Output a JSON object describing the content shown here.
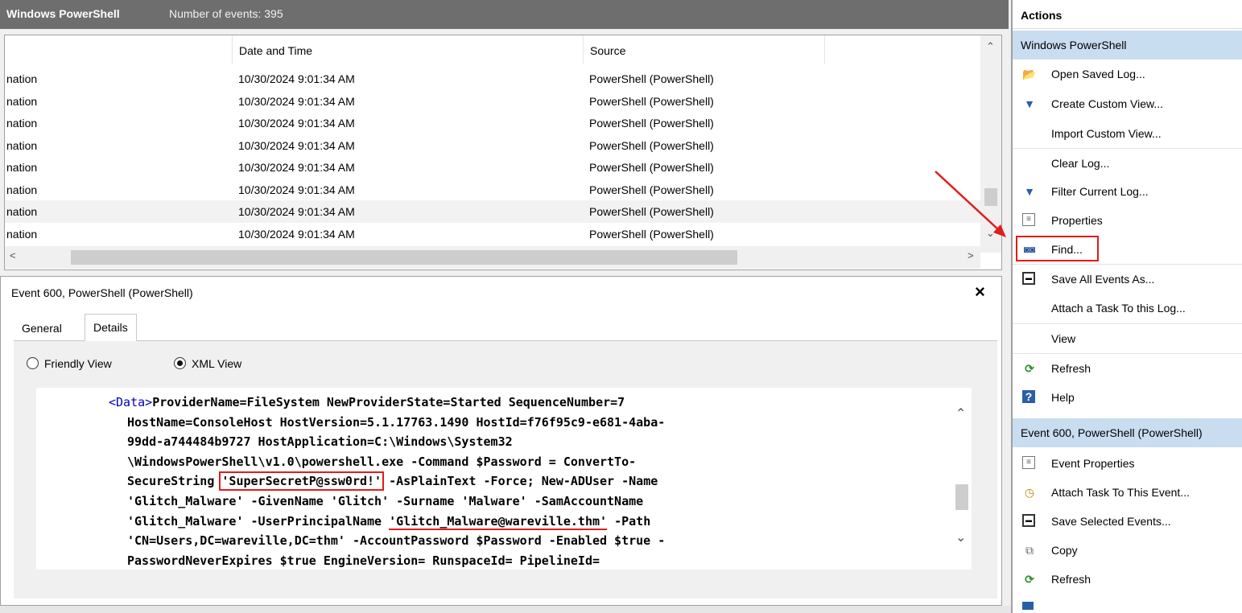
{
  "header": {
    "title": "Windows PowerShell",
    "event_count": "Number of events: 395"
  },
  "event_list": {
    "columns": [
      "",
      "Date and Time",
      "Source"
    ],
    "rows": [
      {
        "level": "nation",
        "date": "10/30/2024 9:01:34 AM",
        "source": "PowerShell (PowerShell)"
      },
      {
        "level": "nation",
        "date": "10/30/2024 9:01:34 AM",
        "source": "PowerShell (PowerShell)"
      },
      {
        "level": "nation",
        "date": "10/30/2024 9:01:34 AM",
        "source": "PowerShell (PowerShell)"
      },
      {
        "level": "nation",
        "date": "10/30/2024 9:01:34 AM",
        "source": "PowerShell (PowerShell)"
      },
      {
        "level": "nation",
        "date": "10/30/2024 9:01:34 AM",
        "source": "PowerShell (PowerShell)"
      },
      {
        "level": "nation",
        "date": "10/30/2024 9:01:34 AM",
        "source": "PowerShell (PowerShell)"
      },
      {
        "level": "nation",
        "date": "10/30/2024 9:01:34 AM",
        "source": "PowerShell (PowerShell)"
      },
      {
        "level": "nation",
        "date": "10/30/2024 9:01:34 AM",
        "source": "PowerShell (PowerShell)"
      }
    ]
  },
  "detail": {
    "title": "Event 600, PowerShell (PowerShell)",
    "close_glyph": "×",
    "tabs": {
      "general": "General",
      "details": "Details"
    },
    "views": {
      "friendly": "Friendly View",
      "xml": "XML View"
    },
    "xml": {
      "tag_open": "<Data>",
      "line1": "ProviderName=FileSystem NewProviderState=Started SequenceNumber=7",
      "line2": "HostName=ConsoleHost HostVersion=5.1.17763.1490 HostId=f76f95c9-e681-4aba-",
      "line3": "99dd-a744484b9727 HostApplication=C:\\Windows\\System32",
      "line4": "\\WindowsPowerShell\\v1.0\\powershell.exe -Command $Password = ConvertTo-",
      "line5_pre": "SecureString ",
      "line5_secret": "'SuperSecretP@ssw0rd!'",
      "line5_post": " -AsPlainText -Force; New-ADUser -Name",
      "line6": "'Glitch_Malware' -GivenName 'Glitch' -Surname 'Malware' -SamAccountName",
      "line7_pre": "'Glitch_Malware' -UserPrincipalName ",
      "line7_upn": "'Glitch_Malware@wareville.thm'",
      "line7_post": " -Path",
      "line8": "'CN=Users,DC=wareville,DC=thm' -AccountPassword $Password -Enabled $true -",
      "line9": "PasswordNeverExpires $true EngineVersion= RunspaceId= PipelineId="
    }
  },
  "actions": {
    "header": "Actions",
    "section1": "Windows PowerShell",
    "section1_items": [
      {
        "label": "Open Saved Log...",
        "icon": "folder-open-icon"
      },
      {
        "label": "Create Custom View...",
        "icon": "filter-icon"
      },
      {
        "label": "Import Custom View...",
        "icon": ""
      },
      {
        "label": "Clear Log...",
        "icon": ""
      },
      {
        "label": "Filter Current Log...",
        "icon": "filter-icon"
      },
      {
        "label": "Properties",
        "icon": "properties-icon"
      },
      {
        "label": "Find...",
        "icon": "binoculars-icon"
      },
      {
        "label": "Save All Events As...",
        "icon": "save-icon"
      },
      {
        "label": "Attach a Task To this Log...",
        "icon": ""
      },
      {
        "label": "View",
        "icon": ""
      },
      {
        "label": "Refresh",
        "icon": "refresh-icon"
      },
      {
        "label": "Help",
        "icon": "help-icon"
      }
    ],
    "section2": "Event 600, PowerShell (PowerShell)",
    "section2_items": [
      {
        "label": "Event Properties",
        "icon": "properties-icon"
      },
      {
        "label": "Attach Task To This Event...",
        "icon": "clock-icon"
      },
      {
        "label": "Save Selected Events...",
        "icon": "save-icon"
      },
      {
        "label": "Copy",
        "icon": "copy-icon"
      },
      {
        "label": "Refresh",
        "icon": "refresh-icon"
      }
    ]
  },
  "colors": {
    "highlight": "#e21b1b",
    "section_bg": "#c9ddf0",
    "xml_tag": "#0000c0"
  }
}
